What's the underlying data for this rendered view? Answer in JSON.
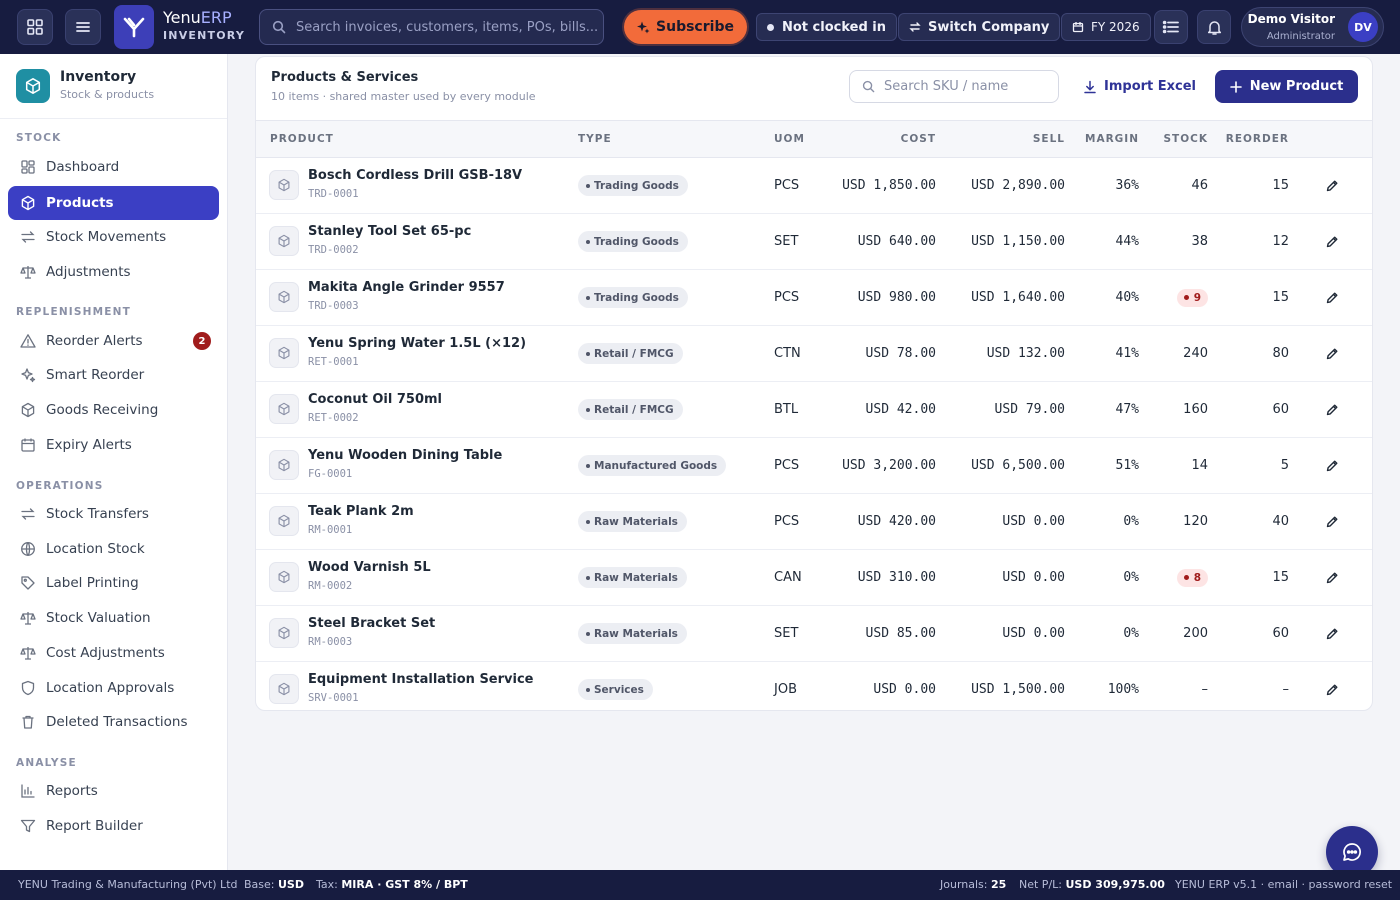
{
  "topbar": {
    "brand_name": "Yenu",
    "brand_suffix": "ERP",
    "module_label": "INVENTORY",
    "search_placeholder": "Search invoices, customers, items, POs, bills...",
    "subscribe_label": "Subscribe",
    "clock_status": "Not clocked in",
    "switch_company_label": "Switch Company",
    "fiscal_year": "FY 2026",
    "user_name": "Demo Visitor",
    "user_role": "Administrator",
    "user_initials": "DV",
    "colors": {
      "bar": "#171c40",
      "subscribe": "#f26b3a",
      "accent": "#3b3fc4"
    }
  },
  "sidebar": {
    "module_title": "Inventory",
    "module_subtitle": "Stock & products",
    "sections": [
      {
        "label": "STOCK",
        "items": [
          {
            "label": "Dashboard",
            "icon": "dashboard-icon"
          },
          {
            "label": "Products",
            "icon": "cube-icon",
            "active": true
          },
          {
            "label": "Stock Movements",
            "icon": "arrows-icon"
          },
          {
            "label": "Adjustments",
            "icon": "scale-icon"
          }
        ]
      },
      {
        "label": "REPLENISHMENT",
        "items": [
          {
            "label": "Reorder Alerts",
            "icon": "warning-icon",
            "badge": "2"
          },
          {
            "label": "Smart Reorder",
            "icon": "sparkle-icon"
          },
          {
            "label": "Goods Receiving",
            "icon": "cube-icon"
          },
          {
            "label": "Expiry Alerts",
            "icon": "calendar-icon"
          }
        ]
      },
      {
        "label": "OPERATIONS",
        "items": [
          {
            "label": "Stock Transfers",
            "icon": "arrows-icon"
          },
          {
            "label": "Location Stock",
            "icon": "globe-icon"
          },
          {
            "label": "Label Printing",
            "icon": "tag-icon"
          },
          {
            "label": "Stock Valuation",
            "icon": "scale-icon"
          },
          {
            "label": "Cost Adjustments",
            "icon": "scale-icon"
          },
          {
            "label": "Location Approvals",
            "icon": "shield-icon"
          },
          {
            "label": "Deleted Transactions",
            "icon": "trash-icon"
          }
        ]
      },
      {
        "label": "ANALYSE",
        "items": [
          {
            "label": "Reports",
            "icon": "bar-chart-icon"
          },
          {
            "label": "Report Builder",
            "icon": "filter-icon"
          }
        ]
      }
    ]
  },
  "products": {
    "title": "Products & Services",
    "subtitle": "10 items · shared master used by every module",
    "search_placeholder": "Search SKU / name",
    "import_label": "Import Excel",
    "new_label": "New Product",
    "columns": {
      "product": "PRODUCT",
      "type": "TYPE",
      "uom": "UOM",
      "cost": "COST",
      "sell": "SELL",
      "margin": "MARGIN",
      "stock": "STOCK",
      "reorder": "REORDER"
    },
    "rows": [
      {
        "name": "Bosch Cordless Drill GSB-18V",
        "sku": "TRD-0001",
        "type": "Trading Goods",
        "uom": "PCS",
        "cost": "USD 1,850.00",
        "sell": "USD 2,890.00",
        "margin": "36%",
        "margin_tone": "good",
        "stock": "46",
        "low": false,
        "reorder": "15"
      },
      {
        "name": "Stanley Tool Set 65-pc",
        "sku": "TRD-0002",
        "type": "Trading Goods",
        "uom": "SET",
        "cost": "USD 640.00",
        "sell": "USD 1,150.00",
        "margin": "44%",
        "margin_tone": "good",
        "stock": "38",
        "low": false,
        "reorder": "12"
      },
      {
        "name": "Makita Angle Grinder 9557",
        "sku": "TRD-0003",
        "type": "Trading Goods",
        "uom": "PCS",
        "cost": "USD 980.00",
        "sell": "USD 1,640.00",
        "margin": "40%",
        "margin_tone": "good",
        "stock": "9",
        "low": true,
        "reorder": "15"
      },
      {
        "name": "Yenu Spring Water 1.5L (×12)",
        "sku": "RET-0001",
        "type": "Retail / FMCG",
        "uom": "CTN",
        "cost": "USD 78.00",
        "sell": "USD 132.00",
        "margin": "41%",
        "margin_tone": "good",
        "stock": "240",
        "low": false,
        "reorder": "80"
      },
      {
        "name": "Coconut Oil 750ml",
        "sku": "RET-0002",
        "type": "Retail / FMCG",
        "uom": "BTL",
        "cost": "USD 42.00",
        "sell": "USD 79.00",
        "margin": "47%",
        "margin_tone": "good",
        "stock": "160",
        "low": false,
        "reorder": "60"
      },
      {
        "name": "Yenu Wooden Dining Table",
        "sku": "FG-0001",
        "type": "Manufactured Goods",
        "uom": "PCS",
        "cost": "USD 3,200.00",
        "sell": "USD 6,500.00",
        "margin": "51%",
        "margin_tone": "good",
        "stock": "14",
        "low": false,
        "reorder": "5"
      },
      {
        "name": "Teak Plank 2m",
        "sku": "RM-0001",
        "type": "Raw Materials",
        "uom": "PCS",
        "cost": "USD 420.00",
        "sell": "USD 0.00",
        "margin": "0%",
        "margin_tone": "zero",
        "stock": "120",
        "low": false,
        "reorder": "40"
      },
      {
        "name": "Wood Varnish 5L",
        "sku": "RM-0002",
        "type": "Raw Materials",
        "uom": "CAN",
        "cost": "USD 310.00",
        "sell": "USD 0.00",
        "margin": "0%",
        "margin_tone": "zero",
        "stock": "8",
        "low": true,
        "reorder": "15"
      },
      {
        "name": "Steel Bracket Set",
        "sku": "RM-0003",
        "type": "Raw Materials",
        "uom": "SET",
        "cost": "USD 85.00",
        "sell": "USD 0.00",
        "margin": "0%",
        "margin_tone": "zero",
        "stock": "200",
        "low": false,
        "reorder": "60"
      },
      {
        "name": "Equipment Installation Service",
        "sku": "SRV-0001",
        "type": "Services",
        "uom": "JOB",
        "cost": "USD 0.00",
        "sell": "USD 1,500.00",
        "margin": "100%",
        "margin_tone": "good",
        "stock": "–",
        "low": false,
        "reorder": "–"
      }
    ]
  },
  "statusbar": {
    "company": "YENU Trading & Manufacturing (Pvt) Ltd",
    "base_label": "Base:",
    "base_value": "USD",
    "tax_label": "Tax:",
    "tax_value": "MIRA · GST 8% / BPT",
    "journals_label": "Journals:",
    "journals_value": "25",
    "pl_label": "Net P/L:",
    "pl_value": "USD 309,975.00",
    "version": "YENU ERP v5.1 · email · password reset"
  }
}
